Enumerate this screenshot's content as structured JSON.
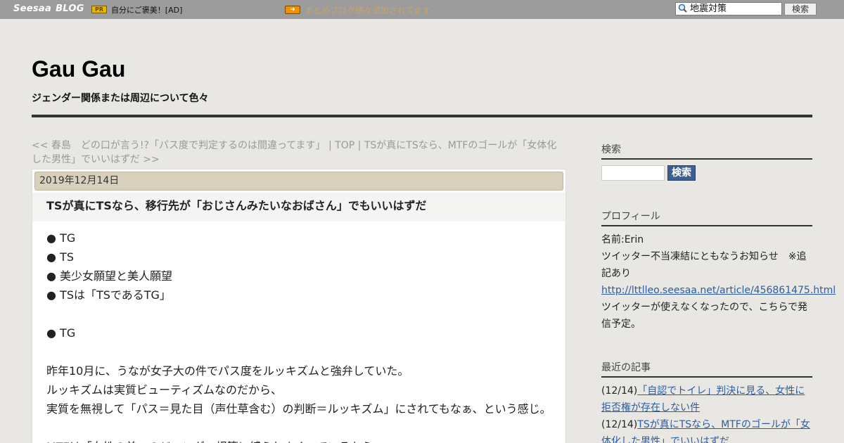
{
  "topbar": {
    "logo_seesaa": "Seesaa",
    "logo_blog": "BLOG",
    "pr_badge": "PR",
    "ad_text": "自分にご褒美！[AD]",
    "notice_text": "まとめブログ続々追加されてます",
    "search_value": "地震対策",
    "search_button": "検索"
  },
  "header": {
    "title": "Gau Gau",
    "subtitle": "ジェンダー関係または周辺について色々"
  },
  "nav": {
    "prev_link": "<< 春島　どの口が言う!?「パス度で判定するのは間違ってます」",
    "sep1": " | ",
    "top_link": "TOP",
    "sep2": " | ",
    "next_link": "TSが真にTSなら、MTFのゴールが「女体化した男性」でいいはずだ >>"
  },
  "article": {
    "date": "2019年12月14日",
    "title": "TSが真にTSなら、移行先が「おじさんみたいなおばさん」でもいいはずだ",
    "lines": [
      "● TG",
      "● TS",
      "● 美少女願望と美人願望",
      "● TSは「TSであるTG」",
      "",
      "● TG",
      "",
      "昨年10月に、うなが女子大の件でパス度をルッキズムと強弁していた。",
      "ルッキズムは実質ビューティズムなのだから、",
      "実質を無視して「パス＝見た目（声仕草含む）の判断＝ルッキズム」にされてもなぁ、という感じ。",
      "",
      "MTFは「女性の美」のジェンダー規範に縛られまくっているから、"
    ]
  },
  "sidebar": {
    "search_heading": "検索",
    "search_button": "検索",
    "profile_heading": "プロフィール",
    "profile_name": "名前:Erin",
    "profile_notice": "ツイッター不当凍結にともなうお知らせ　※追記あり",
    "profile_link": "http://lttlleo.seesaa.net/article/456861475.html",
    "profile_note": "ツイッターが使えなくなったので、こちらで発信予定。",
    "recent_heading": "最近の記事",
    "recent_items": [
      {
        "date": "(12/14)",
        "title": "「自認でトイレ」判決に見る、女性に拒否権が存在しない件"
      },
      {
        "date": "(12/14)",
        "title": "TSが真にTSなら、MTFのゴールが「女体化した男性」でいいはずだ"
      }
    ]
  },
  "colors": {
    "topbar": "#9c9c9c",
    "page_bg": "#e8e7e3",
    "date_bar": "#d7d1bb",
    "link": "#2e5d9c",
    "search_button": "#3d5f8f"
  }
}
